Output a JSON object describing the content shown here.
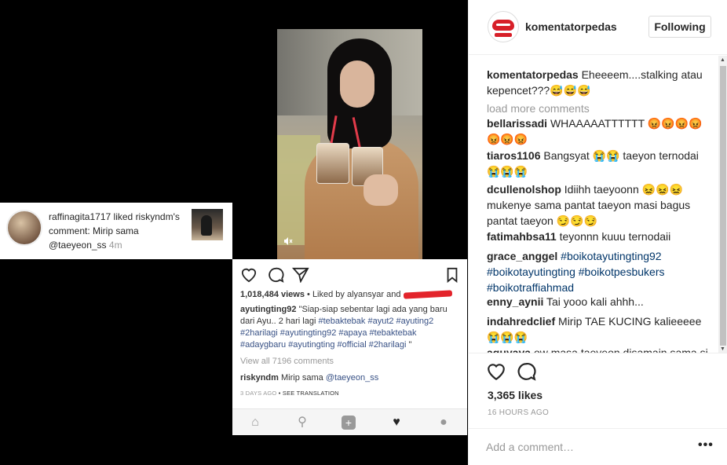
{
  "notification": {
    "user": "raffinagita1717",
    "action": "liked",
    "target": "riskyndm's",
    "comment": "comment: Mirip sama",
    "mention": "@taeyeon_ss",
    "time": "4m"
  },
  "video": {
    "mute_icon": "speaker-muted-icon"
  },
  "embedded_post": {
    "views": "1,018,484 views",
    "liked_by": "• Liked by alyansyar and",
    "caption_user": "ayutingting92",
    "caption_text": "\"Siap-siap sebentar lagi ada yang baru dari Ayu.. 2 hari lagi",
    "caption_tags_1": "#tebaktebak #ayut2 #ayuting2",
    "caption_tags_2": "#2harilagi #ayutingting92 #apaya #tebaktebak",
    "caption_tags_3": "#adaygbaru #ayutingting #official #2harilagi",
    "caption_end": "\"",
    "view_all": "View all 7196 comments",
    "comment_user": "riskyndm",
    "comment_text": "Mirip sama",
    "comment_mention": "@taeyeon_ss",
    "meta": "3 DAYS AGO",
    "translation": "• SEE TRANSLATION"
  },
  "sidebar": {
    "username": "komentatorpedas",
    "follow_label": "Following",
    "load_more": "load more comments",
    "comments": [
      {
        "user": "komentatorpedas",
        "text": "Eheeeem....stalking atau kepencet???😅😅😅"
      },
      {
        "user": "bellarissadi",
        "text": "WHAAAAATTTTTT 😡😡😡😡😡😡😡"
      },
      {
        "user": "tiaros1106",
        "text": "Bangsyat 😭😭 taeyon ternodai 😭😭😭"
      },
      {
        "user": "dcullenolshop",
        "text": "Idiihh taeyoonn 😖😖😖 mukenye sama pantat taeyon masi bagus pantat taeyon 😏😏😏"
      },
      {
        "user": "fatimahbsa11",
        "text": "teyonnn kuuu ternodaii"
      },
      {
        "user": "grace_anggel",
        "text": "#boikotayutingting92 #boikotayutingting #boikotpesbukers #boikotraffiahmad"
      },
      {
        "user": "enny_aynii",
        "text": "Tai yooo kali ahhh..."
      },
      {
        "user": "indahredclief",
        "text": "Mirip TAE KUCING kalieeeee 😭😭😭"
      },
      {
        "user": "aguyaya",
        "text": "ow masa taeyeon disamain sama si"
      }
    ],
    "likes": "3,365 likes",
    "time": "16 HOURS AGO",
    "comment_placeholder": "Add a comment…",
    "more_label": "•••"
  }
}
